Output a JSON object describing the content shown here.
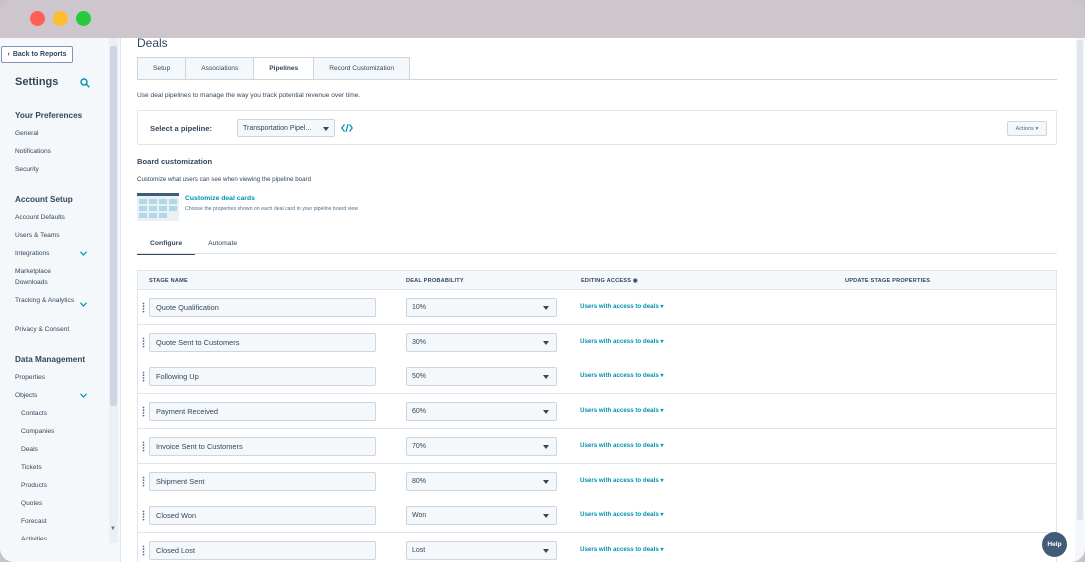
{
  "window": {
    "controls": [
      "#ff5f57",
      "#febc2e",
      "#28c840"
    ]
  },
  "sidebar": {
    "back_label": "Back to Reports",
    "title": "Settings",
    "sections": [
      {
        "heading": "Your Preferences",
        "items": [
          "General",
          "Notifications",
          "Security"
        ]
      },
      {
        "heading": "Account Setup",
        "items": [
          "Account Defaults",
          "Users & Teams",
          "Integrations",
          "Marketplace Downloads",
          "Tracking & Analytics",
          "Privacy & Consent"
        ]
      },
      {
        "heading": "Data Management",
        "items": [
          "Properties",
          "Objects",
          "Contacts",
          "Companies",
          "Deals",
          "Tickets",
          "Products",
          "Quotes",
          "Forecast",
          "Activities"
        ]
      }
    ]
  },
  "main": {
    "title": "Deals",
    "tabs": [
      "Setup",
      "Associations",
      "Pipelines",
      "Record Customization"
    ],
    "active_tab": "Pipelines",
    "intro": "Use deal pipelines to manage the way you track potential revenue over time.",
    "pipeline": {
      "label": "Select a pipeline:",
      "selected": "Transportation Pipel...",
      "actions_label": "Actions"
    },
    "board": {
      "title": "Board customization",
      "desc": "Customize what users can see when viewing the pipeline board",
      "card_link": "Customize deal cards",
      "card_desc": "Choose the properties shown on each deal card in your pipeline board view"
    },
    "subtabs": [
      "Configure",
      "Automate"
    ],
    "table": {
      "headers": [
        "STAGE NAME",
        "DEAL PROBABILITY",
        "EDITING ACCESS",
        "UPDATE STAGE PROPERTIES"
      ],
      "rows": [
        {
          "stage": "Quote Qualification",
          "prob": "10%",
          "access": "Users with access to deals"
        },
        {
          "stage": "Quote Sent to Customers",
          "prob": "30%",
          "access": "Users with access to deals"
        },
        {
          "stage": "Following Up",
          "prob": "50%",
          "access": "Users with access to deals"
        },
        {
          "stage": "Payment Received",
          "prob": "60%",
          "access": "Users with access to deals"
        },
        {
          "stage": "Invoice Sent to Customers",
          "prob": "70%",
          "access": "Users with access to deals"
        },
        {
          "stage": "Shipment Sent",
          "prob": "80%",
          "access": "Users with access to deals"
        },
        {
          "stage": "Closed Won",
          "prob": "Won",
          "access": "Users with access to deals"
        },
        {
          "stage": "Closed Lost",
          "prob": "Lost",
          "access": "Users with access to deals"
        }
      ]
    },
    "help_label": "Help"
  }
}
